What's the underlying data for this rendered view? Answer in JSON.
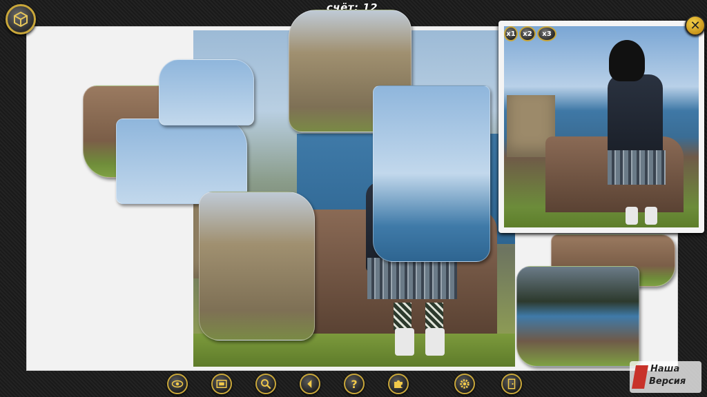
{
  "hud": {
    "score_label": "счёт:",
    "score_value": "12"
  },
  "preview": {
    "zoom_buttons": [
      "x1",
      "x2",
      "x3"
    ]
  },
  "toolbar": {
    "buttons": [
      {
        "name": "eye-icon"
      },
      {
        "name": "picture-icon"
      },
      {
        "name": "magnifier-icon"
      },
      {
        "name": "back-arrow-icon"
      },
      {
        "name": "question-icon"
      },
      {
        "name": "puzzle-piece-icon"
      },
      {
        "name": "gear-icon"
      },
      {
        "name": "exit-door-icon"
      }
    ]
  },
  "logo": {
    "line1": "Наша",
    "line2": "Версия"
  },
  "colors": {
    "accent_gold": "#c9a73a",
    "board_bg": "#f2f2f2",
    "frame_bg": "#1c1c1c"
  }
}
